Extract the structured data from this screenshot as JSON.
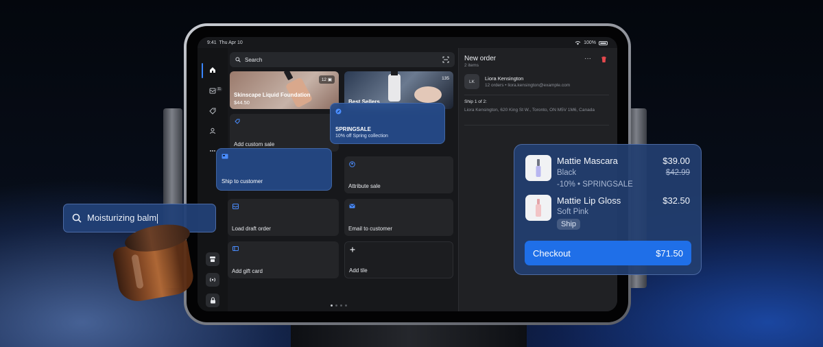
{
  "status_bar": {
    "time": "9:41",
    "date": "Thu Apr 10",
    "battery": "100%"
  },
  "rail": {
    "badge": "11"
  },
  "search": {
    "placeholder": "Search"
  },
  "tiles": {
    "product": {
      "title": "Skinscape Liquid Foundation",
      "price": "$44.50",
      "count": "12"
    },
    "best_sellers": {
      "title": "Best Sellers",
      "count": "135"
    },
    "custom_sale": "Add custom sale",
    "attribute_sale": "Attribute sale",
    "load_draft": "Load draft order",
    "email_customer": "Email to customer",
    "gift_card": "Add gift card",
    "add_tile": "Add tile"
  },
  "promo": {
    "code": "SPRINGSALE",
    "description": "10% off Spring collection"
  },
  "ship_card": {
    "label": "Ship to customer"
  },
  "order": {
    "title": "New order",
    "items_count": "2 items",
    "customer": {
      "initials": "LK",
      "name": "Liora Kensington",
      "meta": "12 orders • liora.kensington@example.com"
    },
    "shipment": {
      "heading": "Ship 1 of 2:",
      "address": "Liora Kensington, 620 King St W., Toronto, ON M5V 1M6, Canada"
    }
  },
  "search_float": {
    "value": "Moisturizing balm"
  },
  "cart": {
    "items": [
      {
        "name": "Mattie Mascara",
        "variant": "Black",
        "discount": "-10% • SPRINGSALE",
        "price": "$39.00",
        "old_price": "$42.99"
      },
      {
        "name": "Mattie Lip Gloss",
        "variant": "Soft Pink",
        "badge": "Ship",
        "price": "$32.50"
      }
    ],
    "checkout_label": "Checkout",
    "checkout_total": "$71.50"
  },
  "colors": {
    "accent": "#1f6fe8",
    "card": "#22406f",
    "screen": "#17181b",
    "delete": "#e5484d"
  },
  "icons": [
    "home-icon",
    "orders-icon",
    "tag-icon",
    "person-icon",
    "more-icon",
    "scan-icon",
    "trash-icon",
    "lock-icon",
    "store-icon",
    "broadcast-icon"
  ]
}
